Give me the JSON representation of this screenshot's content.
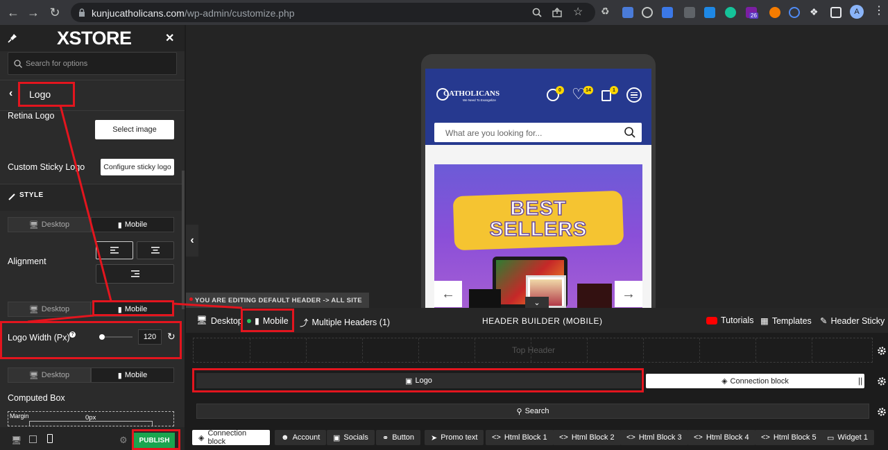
{
  "browser": {
    "url_host": "kunjucatholicans.com",
    "url_path": "/wp-admin/customize.php",
    "profile_initial": "A",
    "ext_badge": "26"
  },
  "panel": {
    "brand": "XSTORE",
    "search_placeholder": "Search for options",
    "section_title": "Logo",
    "retina_logo_label": "Retina Logo",
    "select_image_button": "Select image",
    "custom_sticky_logo_label": "Custom Sticky Logo",
    "configure_sticky_button": "Configure sticky logo",
    "style_heading": "STYLE",
    "tabs1": [
      "Desktop",
      "Mobile"
    ],
    "alignment_label": "Alignment",
    "tabs2": [
      "Desktop",
      "Mobile"
    ],
    "logo_width_label": "Logo Width (Px)",
    "logo_width_value": "120",
    "logo_width_fraction": 0.0,
    "tabs3": [
      "Desktop",
      "Mobile"
    ],
    "computed_box_label": "Computed Box",
    "margin_label": "Margin",
    "margin_value": "0px",
    "publish_button": "PUBLISH"
  },
  "preview": {
    "site_logo_text": "CATHOLICANS",
    "site_logo_sub": "We Need To Evangelize",
    "badge_notifications": "0",
    "badge_wishlist": "14",
    "badge_cart": "1",
    "site_search_placeholder": "What are you looking for...",
    "banner_text_1": "BEST",
    "banner_text_2": "SELLERS",
    "editing_notice": "YOU ARE EDITING DEFAULT HEADER -> ALL SITE"
  },
  "builder": {
    "tab_desktop": "Desktop",
    "tab_mobile": "Mobile",
    "tab_multiple": "Multiple Headers (1)",
    "title": "HEADER BUILDER (MOBILE)",
    "link_tutorials": "Tutorials",
    "link_templates": "Templates",
    "link_header_sticky": "Header Sticky",
    "row_top_header": "Top Header",
    "element_logo": "Logo",
    "element_connection": "Connection block",
    "element_search": "Search",
    "chips": [
      "Connection block",
      "Account",
      "Socials",
      "Button",
      "Promo text",
      "Html Block 1",
      "Html Block 2",
      "Html Block 3",
      "Html Block 4",
      "Html Block 5",
      "Widget 1"
    ]
  },
  "colors": {
    "accent_red": "#e3151e",
    "publish_green": "#1aa54f",
    "site_blue": "#26398f",
    "badge_yellow": "#ffd700"
  }
}
